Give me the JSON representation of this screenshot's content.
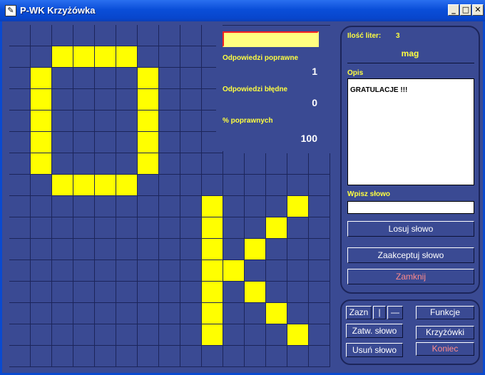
{
  "window": {
    "title": "P-WK Krzyżówka"
  },
  "titlebar_buttons": {
    "minimize": "_",
    "maximize": "□",
    "close": "✕"
  },
  "stats": {
    "correct_label": "Odpowiedzi poprawne",
    "correct_value": "1",
    "wrong_label": "Odpowiedzi błędne",
    "wrong_value": "0",
    "percent_label": "% poprawnych",
    "percent_value": "100"
  },
  "panel": {
    "letters_label": "Ilość liter:",
    "letters_value": "3",
    "word": "mag",
    "description_label": "Opis",
    "description_text": "GRATULACJE !!!",
    "input_label": "Wpisz słowo",
    "input_value": "",
    "random_button": "Losuj słowo",
    "accept_button": "Zaakceptuj słowo",
    "close_button": "Zamknij"
  },
  "bottom_panel": {
    "select_label": "Zazn",
    "vertical_symbol": "|",
    "horizontal_symbol": "—",
    "confirm_button": "Zatw. słowo",
    "delete_button": "Usuń słowo",
    "functions_button": "Funkcje",
    "crosswords_button": "Krzyżówki",
    "exit_button": "Koniec"
  },
  "colors": {
    "background": "#3a4a93",
    "highlight": "#ffff00",
    "label": "#ffff40",
    "danger": "#ff8a8a"
  },
  "board": {
    "cols": 15,
    "rows": 16,
    "filled": [
      [
        1,
        2
      ],
      [
        1,
        3
      ],
      [
        1,
        4
      ],
      [
        1,
        5
      ],
      [
        2,
        1
      ],
      [
        2,
        6
      ],
      [
        3,
        1
      ],
      [
        3,
        6
      ],
      [
        4,
        1
      ],
      [
        4,
        6
      ],
      [
        5,
        1
      ],
      [
        5,
        6
      ],
      [
        6,
        1
      ],
      [
        6,
        6
      ],
      [
        7,
        2
      ],
      [
        7,
        3
      ],
      [
        7,
        4
      ],
      [
        7,
        5
      ],
      [
        8,
        9
      ],
      [
        8,
        13
      ],
      [
        9,
        9
      ],
      [
        9,
        12
      ],
      [
        10,
        9
      ],
      [
        10,
        11
      ],
      [
        11,
        9
      ],
      [
        11,
        10
      ],
      [
        12,
        9
      ],
      [
        12,
        11
      ],
      [
        13,
        9
      ],
      [
        13,
        12
      ],
      [
        14,
        9
      ],
      [
        14,
        13
      ]
    ]
  }
}
